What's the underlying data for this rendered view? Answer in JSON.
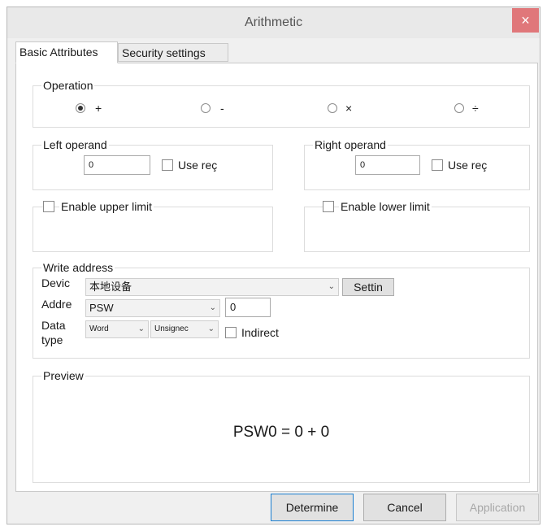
{
  "window": {
    "title": "Arithmetic",
    "close_glyph": "×"
  },
  "tabs": [
    {
      "label": "Basic Attributes",
      "active": true
    },
    {
      "label": "Security settings",
      "active": false
    }
  ],
  "operation": {
    "legend": "Operation",
    "options": [
      {
        "label": "+",
        "checked": true
      },
      {
        "label": "-",
        "checked": false
      },
      {
        "label": "×",
        "checked": false
      },
      {
        "label": "÷",
        "checked": false
      }
    ]
  },
  "left_operand": {
    "legend": "Left operand",
    "value": "0",
    "use_reg_label": "Use reç",
    "use_reg_checked": false
  },
  "right_operand": {
    "legend": "Right operand",
    "value": "0",
    "use_reg_label": "Use reç",
    "use_reg_checked": false
  },
  "upper_limit": {
    "label": "Enable upper limit",
    "checked": false
  },
  "lower_limit": {
    "label": "Enable lower limit",
    "checked": false
  },
  "write_address": {
    "legend": "Write address",
    "device_label": "Devic",
    "device_value": "本地设备",
    "settings_label": "Settin",
    "address_label": "Addre",
    "address_value": "PSW",
    "address_offset": "0",
    "data_type_label_1": "Data",
    "data_type_label_2": "type",
    "data_type_value": "Word",
    "sign_value": "Unsignec",
    "indirect_label": "Indirect",
    "indirect_checked": false
  },
  "preview": {
    "legend": "Preview",
    "expression": "PSW0 = 0 + 0"
  },
  "buttons": {
    "determine": "Determine",
    "cancel": "Cancel",
    "application": "Application"
  },
  "icons": {
    "chevron": "⌄"
  },
  "colors": {
    "close_bg": "#e0777a",
    "primary_border": "#1a7fd1"
  }
}
